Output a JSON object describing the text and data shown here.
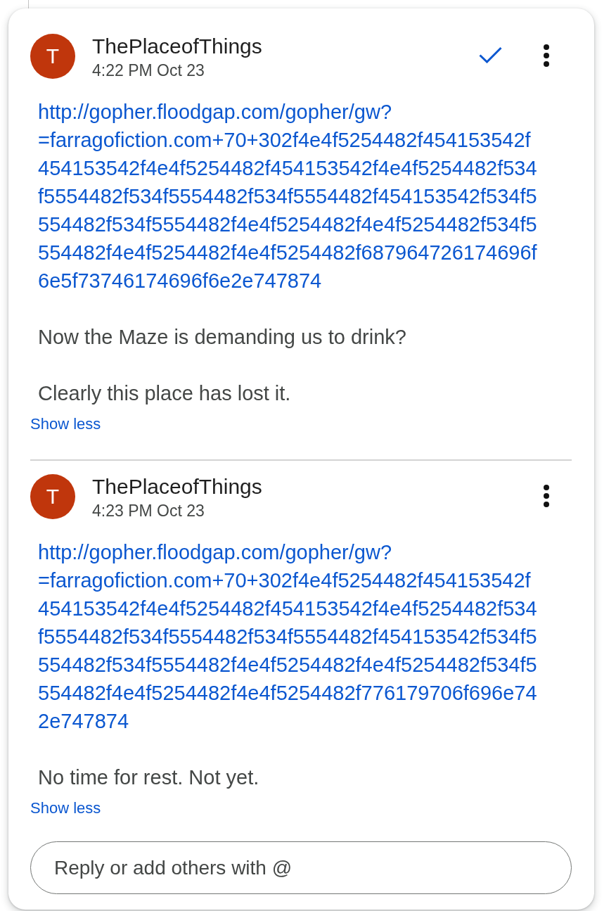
{
  "comments": [
    {
      "author": "ThePlaceofThings",
      "avatar_letter": "T",
      "time": "4:22 PM Oct 23",
      "resolve_button": true,
      "link": "http://gopher.floodgap.com/gopher/gw?=farragofiction.com+70+302f4e4f5254482f454153542f454153542f4e4f5254482f454153542f4e4f5254482f534f5554482f534f5554482f534f5554482f454153542f534f5554482f534f5554482f4e4f5254482f4e4f5254482f534f5554482f4e4f5254482f4e4f5254482f687964726174696f6e5f73746174696f6e2e747874",
      "paragraphs": [
        "Now the Maze is demanding us to drink?",
        "Clearly this place has lost it."
      ],
      "toggle": "Show less"
    },
    {
      "author": "ThePlaceofThings",
      "avatar_letter": "T",
      "time": "4:23 PM Oct 23",
      "resolve_button": false,
      "link": "http://gopher.floodgap.com/gopher/gw?=farragofiction.com+70+302f4e4f5254482f454153542f454153542f4e4f5254482f454153542f4e4f5254482f534f5554482f534f5554482f534f5554482f454153542f534f5554482f534f5554482f4e4f5254482f4e4f5254482f534f5554482f4e4f5254482f4e4f5254482f776179706f696e742e747874",
      "paragraphs": [
        "No time for rest. Not yet."
      ],
      "toggle": "Show less"
    }
  ],
  "reply": {
    "placeholder": "Reply or add others with @"
  }
}
